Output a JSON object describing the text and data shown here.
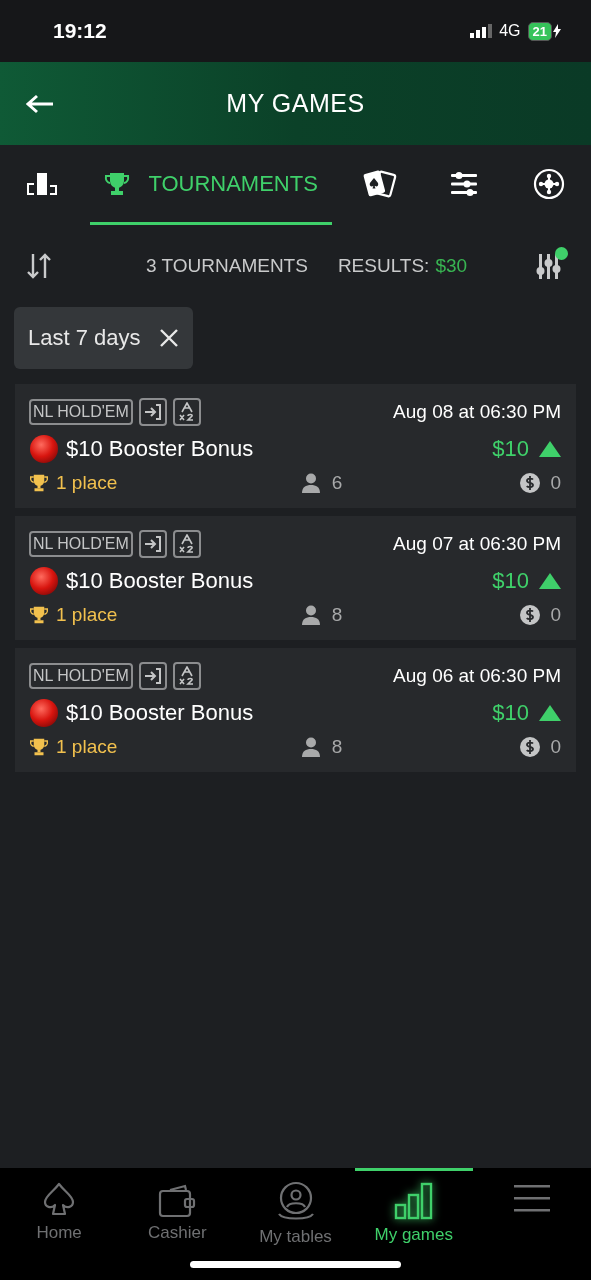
{
  "status_bar": {
    "time": "19:12",
    "network": "4G",
    "battery": "21"
  },
  "header": {
    "title": "MY GAMES"
  },
  "tabs": [
    {
      "selected": false
    },
    {
      "label": "TOURNAMENTS",
      "selected": true
    },
    {
      "selected": false
    },
    {
      "selected": false
    },
    {
      "selected": false
    }
  ],
  "summary": {
    "count": "3 TOURNAMENTS",
    "results_label": "RESULTS:",
    "results_value": "$30",
    "filters_active": true
  },
  "filter_chip": {
    "label": "Last 7 days"
  },
  "tournaments": [
    {
      "game": "NL HOLD'EM",
      "date": "Aug 08 at 06:30 PM",
      "name": "$10 Booster Bonus",
      "prize": "$10",
      "place": "1 place",
      "players": "6",
      "bounty": "0"
    },
    {
      "game": "NL HOLD'EM",
      "date": "Aug 07 at 06:30 PM",
      "name": "$10 Booster Bonus",
      "prize": "$10",
      "place": "1 place",
      "players": "8",
      "bounty": "0"
    },
    {
      "game": "NL HOLD'EM",
      "date": "Aug 06 at 06:30 PM",
      "name": "$10 Booster Bonus",
      "prize": "$10",
      "place": "1 place",
      "players": "8",
      "bounty": "0"
    }
  ],
  "bottom_nav": [
    {
      "label": "Home",
      "selected": false
    },
    {
      "label": "Cashier",
      "selected": false
    },
    {
      "label": "My tables",
      "selected": false
    },
    {
      "label": "My games",
      "selected": true
    },
    {
      "selected": false
    }
  ]
}
